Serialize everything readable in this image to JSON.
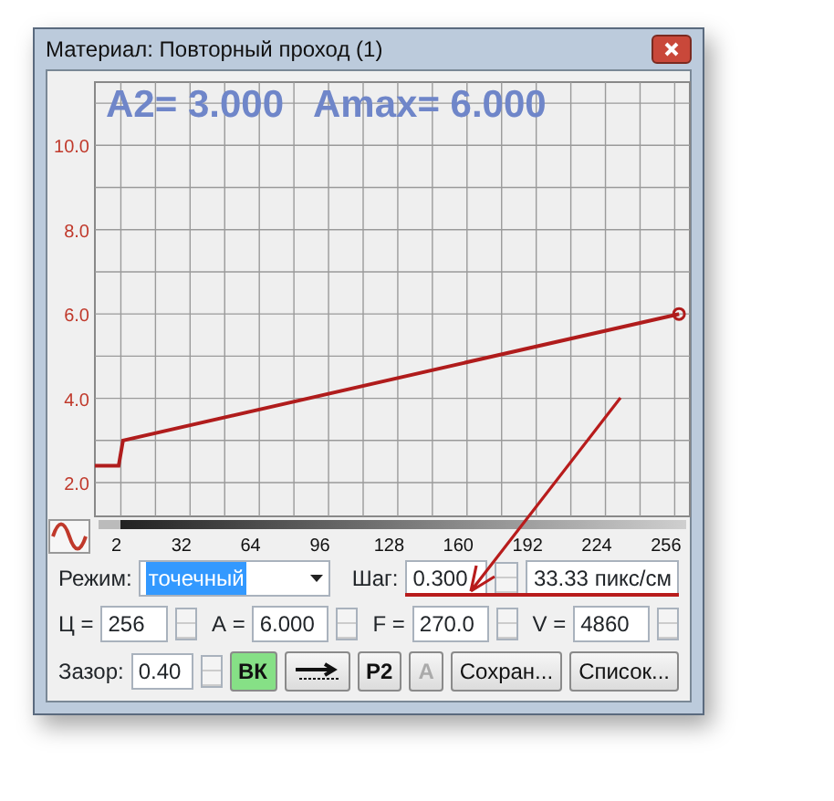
{
  "window": {
    "title": "Материал: Повторный проход (1)"
  },
  "chart": {
    "readouts": [
      "A2= 3.000",
      "Amax= 6.000"
    ],
    "chart_data": {
      "type": "line",
      "grid": true,
      "x": [
        -10,
        1,
        3,
        260
      ],
      "series": [
        {
          "color": "#b01c1c",
          "values": [
            2.4,
            2.4,
            3.0,
            6.0
          ]
        }
      ],
      "xlim": [
        -10,
        265
      ],
      "ylim": [
        1.2,
        11.5
      ],
      "xticks": [
        2,
        32,
        64,
        96,
        128,
        160,
        192,
        224,
        256
      ],
      "yticks": [
        {
          "value": 2,
          "label": "2.0"
        },
        {
          "value": 4,
          "label": "4.0"
        },
        {
          "value": 6,
          "label": "6.0"
        },
        {
          "value": 8,
          "label": "8.0"
        },
        {
          "value": 10,
          "label": "10.0"
        }
      ]
    }
  },
  "mode": {
    "label": "Режим:",
    "value": "точечный"
  },
  "step": {
    "label": "Шаг:",
    "value": "0.300"
  },
  "scale": "33.33 пикс/см",
  "params": [
    {
      "label": "Ц =",
      "value": "256"
    },
    {
      "label": "А =",
      "value": "6.000"
    },
    {
      "label": "F =",
      "value": "270.0"
    },
    {
      "label": "V =",
      "value": "4860"
    }
  ],
  "gap": {
    "label": "Зазор:",
    "value": "0.40"
  },
  "buttons": [
    {
      "kind": "text",
      "label": "ВК",
      "on": true,
      "disabled": false
    },
    {
      "kind": "icon",
      "on": false,
      "disabled": false
    },
    {
      "kind": "text",
      "label": "P2",
      "on": false,
      "disabled": false
    },
    {
      "kind": "text",
      "label": "A",
      "on": false,
      "disabled": true
    },
    {
      "kind": "text",
      "label": "Сохран...",
      "on": false,
      "disabled": false
    },
    {
      "kind": "text",
      "label": "Список...",
      "on": false,
      "disabled": false
    }
  ]
}
